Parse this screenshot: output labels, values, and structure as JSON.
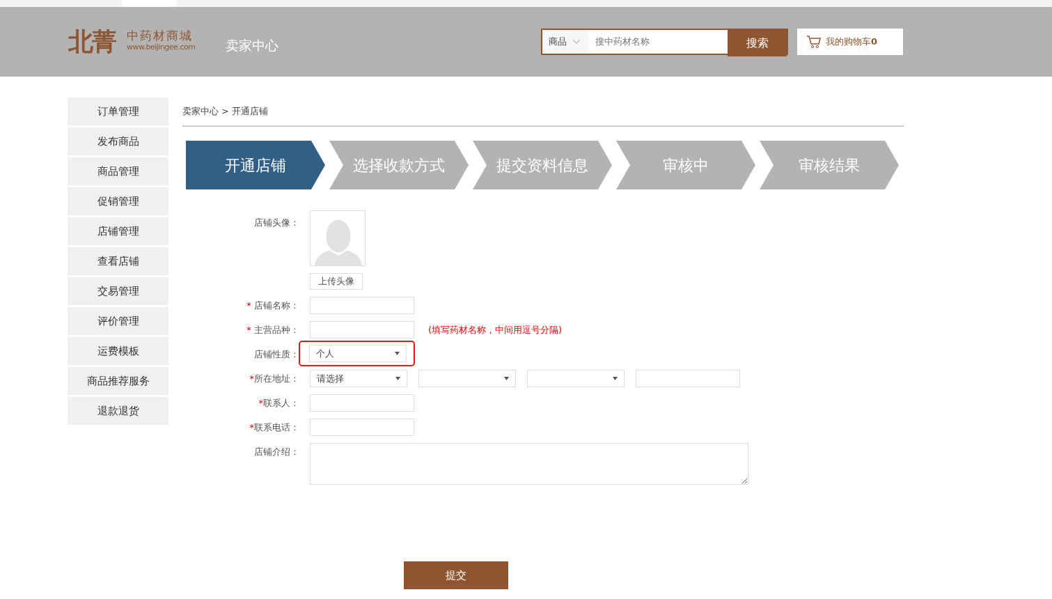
{
  "header": {
    "logo_mark": "北菁",
    "logo_title": "中药材商城",
    "logo_url": "www.beijingee.com",
    "section": "卖家中心",
    "search": {
      "category": "商品",
      "placeholder": "搜中药材名称",
      "button": "搜索"
    },
    "cart": {
      "label": "我的购物车",
      "count": "0"
    }
  },
  "sidebar": {
    "items": [
      {
        "label": "订单管理",
        "selected": false
      },
      {
        "label": "发布商品",
        "selected": false
      },
      {
        "label": "商品管理",
        "selected": false
      },
      {
        "label": "促销管理",
        "selected": false
      },
      {
        "label": "店铺管理",
        "selected": false
      },
      {
        "label": "查看店铺",
        "selected": false
      },
      {
        "label": "交易管理",
        "selected": false
      },
      {
        "label": "评价管理",
        "selected": false
      },
      {
        "label": "运费模板",
        "selected": false
      },
      {
        "label": "商品推荐服务",
        "selected": false
      },
      {
        "label": "退款退货",
        "selected": false
      }
    ]
  },
  "breadcrumb": [
    "卖家中心",
    "开通店铺"
  ],
  "breadcrumb_separator": ">",
  "steps": [
    {
      "label": "开通店铺",
      "selected": true
    },
    {
      "label": "选择收款方式",
      "selected": false
    },
    {
      "label": "提交资料信息",
      "selected": false
    },
    {
      "label": "审核中",
      "selected": false
    },
    {
      "label": "审核结果",
      "selected": false
    }
  ],
  "form": {
    "rows": [
      {
        "label": "店铺头像：",
        "highlighted": false,
        "controls": [
          {
            "kind": "avatar",
            "button": "上传头像"
          }
        ]
      },
      {
        "label": "店铺名称：",
        "asterisk": "* ",
        "highlighted": false,
        "controls": [
          {
            "kind": "text"
          }
        ]
      },
      {
        "label": "主营品种：",
        "asterisk": "* ",
        "highlighted": false,
        "controls": [
          {
            "kind": "text"
          }
        ],
        "hint": "(填写药材名称，中间用逗号分隔)"
      },
      {
        "label": "店铺性质：",
        "highlighted": true,
        "controls": [
          {
            "kind": "select",
            "value": "个人"
          }
        ]
      },
      {
        "label": "所在地址：",
        "asterisk": "*",
        "highlighted": false,
        "controls": [
          {
            "kind": "select",
            "value": "请选择"
          },
          {
            "kind": "select"
          },
          {
            "kind": "select"
          },
          {
            "kind": "text"
          }
        ]
      },
      {
        "label": "联系人：",
        "asterisk": "*",
        "highlighted": false,
        "controls": [
          {
            "kind": "text"
          }
        ]
      },
      {
        "label": "联系电话：",
        "asterisk": "*",
        "highlighted": false,
        "controls": [
          {
            "kind": "text"
          }
        ]
      },
      {
        "label": "店铺介绍：",
        "highlighted": false,
        "controls": [
          {
            "kind": "textarea"
          }
        ]
      }
    ],
    "submit": "提交"
  }
}
